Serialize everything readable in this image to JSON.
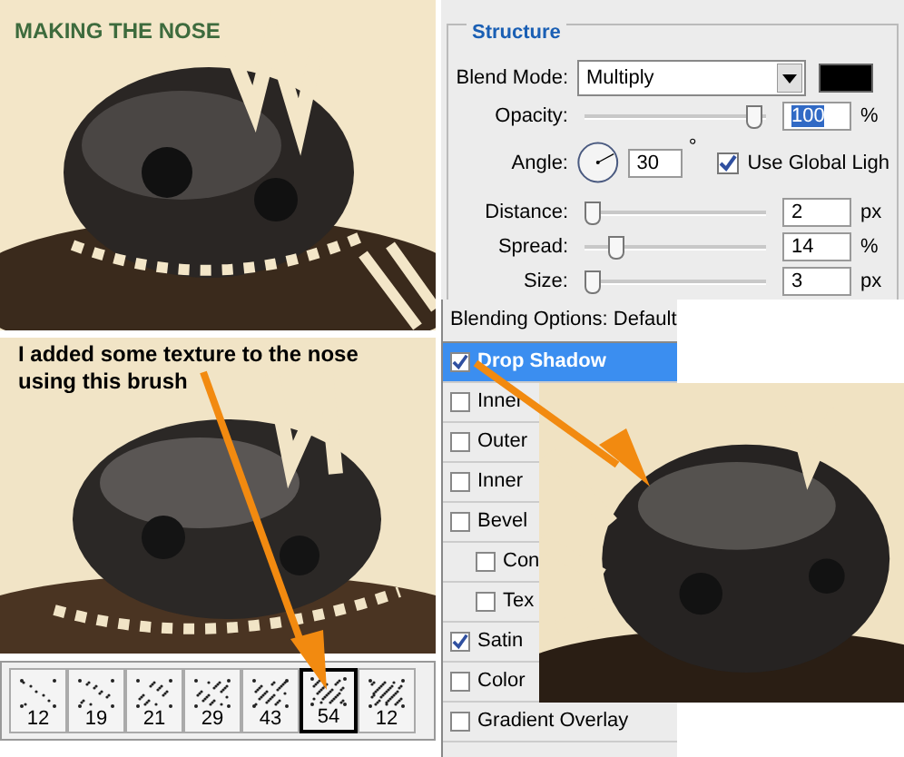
{
  "title": "MAKING THE NOSE",
  "caption": "I added some texture to the nose using this brush",
  "structure": {
    "legend": "Structure",
    "blend_mode": {
      "label": "Blend Mode:",
      "value": "Multiply"
    },
    "opacity": {
      "label": "Opacity:",
      "level": 0.97,
      "value": "100",
      "unit": "%"
    },
    "angle": {
      "label": "Angle:",
      "value": "30",
      "unit": "°"
    },
    "global_light": {
      "label": "Use Global Ligh",
      "checked": true
    },
    "sliders": [
      {
        "label": "Distance:",
        "level": 0.0,
        "value": "2",
        "unit": "px"
      },
      {
        "label": "Spread:",
        "level": 0.14,
        "value": "14",
        "unit": "%"
      },
      {
        "label": "Size:",
        "level": 0.0,
        "value": "3",
        "unit": "px"
      }
    ]
  },
  "layer_styles": {
    "header": "Blending Options: Default",
    "items": [
      {
        "label": "Drop Shadow",
        "checked": true,
        "selected": true,
        "kind": "main"
      },
      {
        "label": "Inner",
        "checked": false,
        "selected": false,
        "kind": "main"
      },
      {
        "label": "Outer",
        "checked": false,
        "selected": false,
        "kind": "main"
      },
      {
        "label": "Inner",
        "checked": false,
        "selected": false,
        "kind": "main"
      },
      {
        "label": "Bevel",
        "checked": false,
        "selected": false,
        "kind": "main"
      },
      {
        "label": "Con",
        "checked": false,
        "selected": false,
        "kind": "sub"
      },
      {
        "label": "Tex",
        "checked": false,
        "selected": false,
        "kind": "sub"
      },
      {
        "label": "Satin",
        "checked": true,
        "selected": false,
        "kind": "main"
      },
      {
        "label": "Color",
        "checked": false,
        "selected": false,
        "kind": "main"
      },
      {
        "label": "Gradient Overlay",
        "checked": false,
        "selected": false,
        "kind": "main"
      }
    ]
  },
  "brushes": [
    {
      "size": "12",
      "selected": false
    },
    {
      "size": "19",
      "selected": false
    },
    {
      "size": "21",
      "selected": false
    },
    {
      "size": "29",
      "selected": false
    },
    {
      "size": "43",
      "selected": false
    },
    {
      "size": "54",
      "selected": true
    },
    {
      "size": "12",
      "selected": false
    }
  ]
}
